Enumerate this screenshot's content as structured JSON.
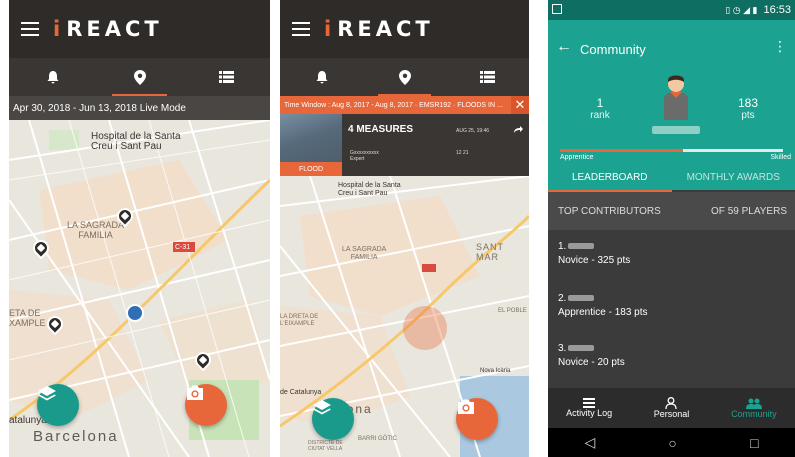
{
  "brand": {
    "initial": "i",
    "rest": "REACT"
  },
  "screen1": {
    "timebar": "Apr 30, 2018 - Jun 13, 2018  Live Mode",
    "labels": {
      "hospital": "Hospital de la Santa\nCreu i Sant Pau",
      "sagrada": "LA SAGRADA\nFAMILIA",
      "road": "C-31",
      "eixample": "ETA DE\nXAMPLE",
      "catalunya": "atalunya",
      "city": "Barcelona"
    }
  },
  "screen2": {
    "alert": "Time Window : Aug 8, 2017 - Aug 8, 2017 · EMSR192 · FLOODS IN ...",
    "close": "✕",
    "event": {
      "title": "4 MEASURES",
      "date": "AUG 25, 19:46",
      "user": "Gxxxxxxxxxx",
      "role": "Expert",
      "stats": "12  21",
      "tag": "FLOOD"
    },
    "labels": {
      "hospital": "Hospital de la Santa\nCreu i Sant Pau",
      "sagrada": "LA SAGRADA\nFAMILIA",
      "santmar": "SANT MAR",
      "eixample": "LA DRETA DE\nL'EIXAMPLE",
      "poble": "EL POBLE",
      "icaria": "Nova Icària",
      "catalunya": "de Catalunya",
      "city": "lona",
      "gotic": "BARRI GÒTIC",
      "districte": "DISTRICTE DE\nCIUTAT VELLA"
    }
  },
  "screen3": {
    "status_time": "16:53",
    "title": "Community",
    "rank": {
      "value": "1",
      "label": "rank"
    },
    "pts": {
      "value": "183",
      "label": "pts"
    },
    "progress": 0.55,
    "level_left": "Apprentice",
    "level_right": "Skilled",
    "tabs": [
      "LEADERBOARD",
      "MONTHLY AWARDS"
    ],
    "top_contributors": "TOP CONTRIBUTORS",
    "players": "OF 59 PLAYERS",
    "contributors": [
      {
        "rank": "1.",
        "detail": "Novice - 325 pts"
      },
      {
        "rank": "2.",
        "detail": "Apprentice - 183 pts"
      },
      {
        "rank": "3.",
        "detail": "Novice - 20 pts"
      }
    ],
    "nav": [
      "Activity Log",
      "Personal",
      "Community"
    ],
    "colors": {
      "teal": "#1ba290",
      "accent": "#e8673a"
    }
  }
}
